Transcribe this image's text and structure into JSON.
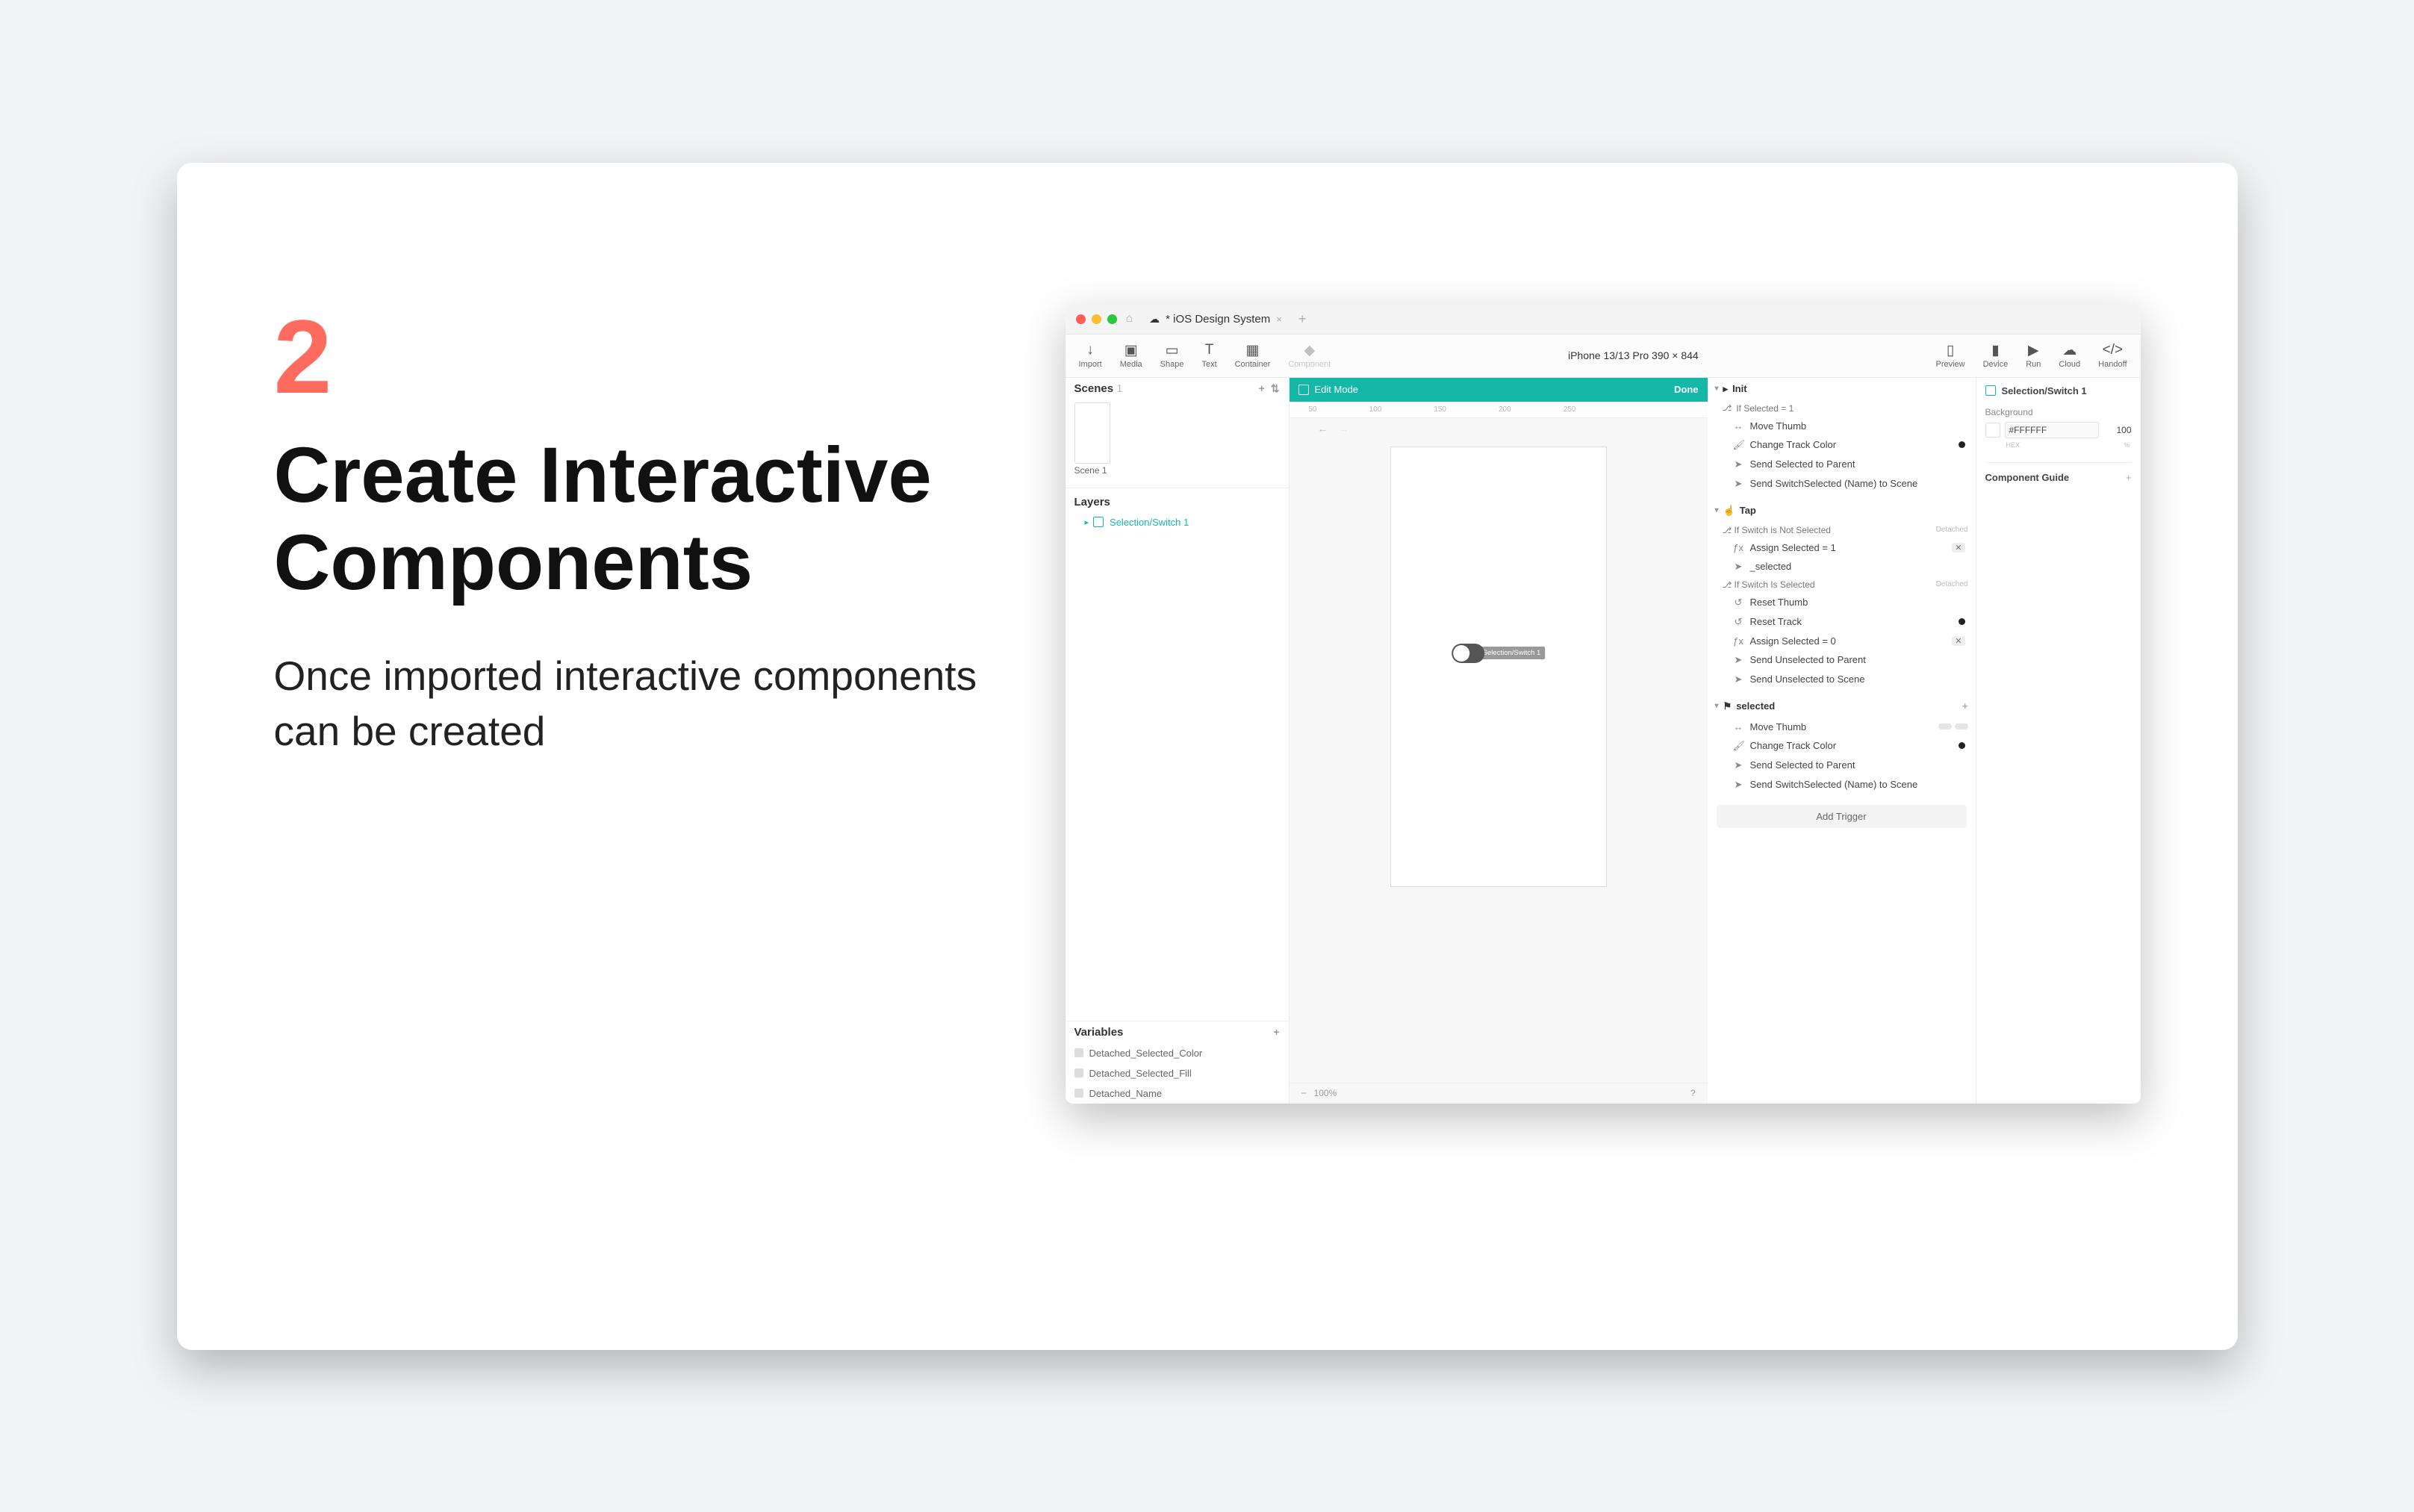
{
  "slide": {
    "step_number": "2",
    "title": "Create Interactive Components",
    "description": "Once imported interactive components can be created"
  },
  "app": {
    "tab_title": "* iOS Design System",
    "toolbar": {
      "left": [
        "Import",
        "Media",
        "Shape",
        "Text",
        "Container",
        "Component"
      ],
      "center": "iPhone 13/13 Pro  390 × 844",
      "right": [
        "Preview",
        "Device",
        "Run",
        "Cloud",
        "Handoff"
      ]
    },
    "scenes": {
      "title": "Scenes",
      "count": "1",
      "item": "Scene 1"
    },
    "layers": {
      "title": "Layers",
      "item": "Selection/Switch 1"
    },
    "variables": {
      "title": "Variables",
      "items": [
        "Detached_Selected_Color",
        "Detached_Selected_Fill",
        "Detached_Name"
      ]
    },
    "canvas": {
      "edit_mode": "Edit Mode",
      "done": "Done",
      "ruler_ticks": [
        "50",
        "100",
        "150",
        "200",
        "250"
      ],
      "zoom": "100%",
      "switch_label": "Selection/Switch 1"
    },
    "actions": {
      "group_init": "Init",
      "cond_if_selected": "If Selected = 1",
      "a_move_thumb": "Move Thumb",
      "a_change_track": "Change Track Color",
      "a_send_parent": "Send Selected to Parent",
      "a_send_scene": "Send SwitchSelected (Name) to Scene",
      "group_tap": "Tap",
      "cond_not_selected": "If Switch is Not Selected",
      "a_assign1": "Assign Selected = 1",
      "a_selected": "_selected",
      "cond_is_selected": "If Switch Is Selected",
      "a_reset_thumb": "Reset Thumb",
      "a_reset_track": "Reset Track",
      "a_assign0": "Assign Selected = 0",
      "a_send_unsel_parent": "Send Unselected to Parent",
      "a_send_unsel_scene": "Send Unselected to Scene",
      "group_selected": "selected",
      "a_move_thumb2": "Move Thumb",
      "a_change_track2": "Change Track Color",
      "a_send_parent2": "Send Selected to Parent",
      "a_send_scene2": "Send SwitchSelected (Name) to Scene",
      "add_trigger": "Add Trigger",
      "badge_detached": "Detached"
    },
    "inspector": {
      "title": "Selection/Switch 1",
      "bg_label": "Background",
      "bg_hex": "#FFFFFF",
      "bg_alpha": "100",
      "hex_caption": "HEX",
      "pct_caption": "%",
      "guide": "Component Guide"
    }
  }
}
